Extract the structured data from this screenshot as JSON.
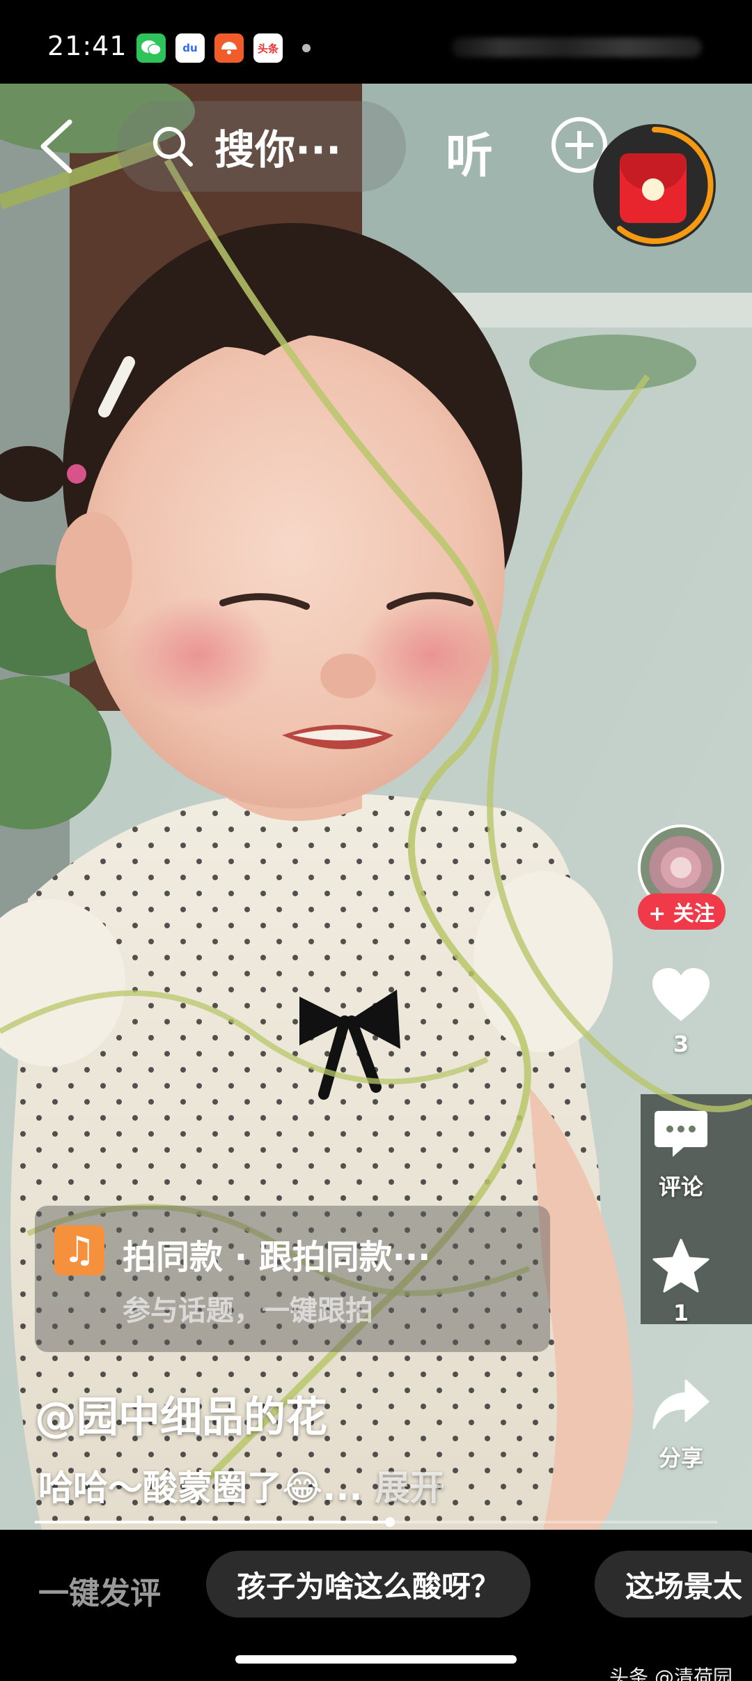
{
  "status_bar": {
    "time": "21:41",
    "notifications": [
      {
        "name": "wechat-notification-icon",
        "label": "",
        "bg": "#2ec45b"
      },
      {
        "name": "baidu-notification-icon",
        "label": "du",
        "bg": "#2f6bf0"
      },
      {
        "name": "xigua-notification-icon",
        "label": "",
        "bg": "#f25c2a"
      },
      {
        "name": "toutiao-notification-icon",
        "label": "头条",
        "bg": "#e8312f"
      }
    ]
  },
  "top_bar": {
    "search_text": "搜你···",
    "listen_label": "听"
  },
  "right_rail": {
    "follow_label": "+ 关注",
    "like_count": "3",
    "comment_label": "评论",
    "favorite_count": "1",
    "share_label": "分享"
  },
  "music_card": {
    "title": "拍同款  ·  跟拍同款···",
    "subtitle": "参与话题，一键跟拍"
  },
  "post": {
    "author": "@园中细品的花",
    "description": "哈哈～酸蒙圈了😂...",
    "expand_label": "展开",
    "progress": 0.52
  },
  "comment_bar": {
    "quick_comment_label": "一键发评",
    "chips": [
      "孩子为啥这么酸呀？",
      "这场景太"
    ]
  },
  "watermark": "头条 @清荷园",
  "colors": {
    "accent_red": "#f03a4a",
    "timer_orange": "#f59a12",
    "music_orange": "#f5903d"
  }
}
